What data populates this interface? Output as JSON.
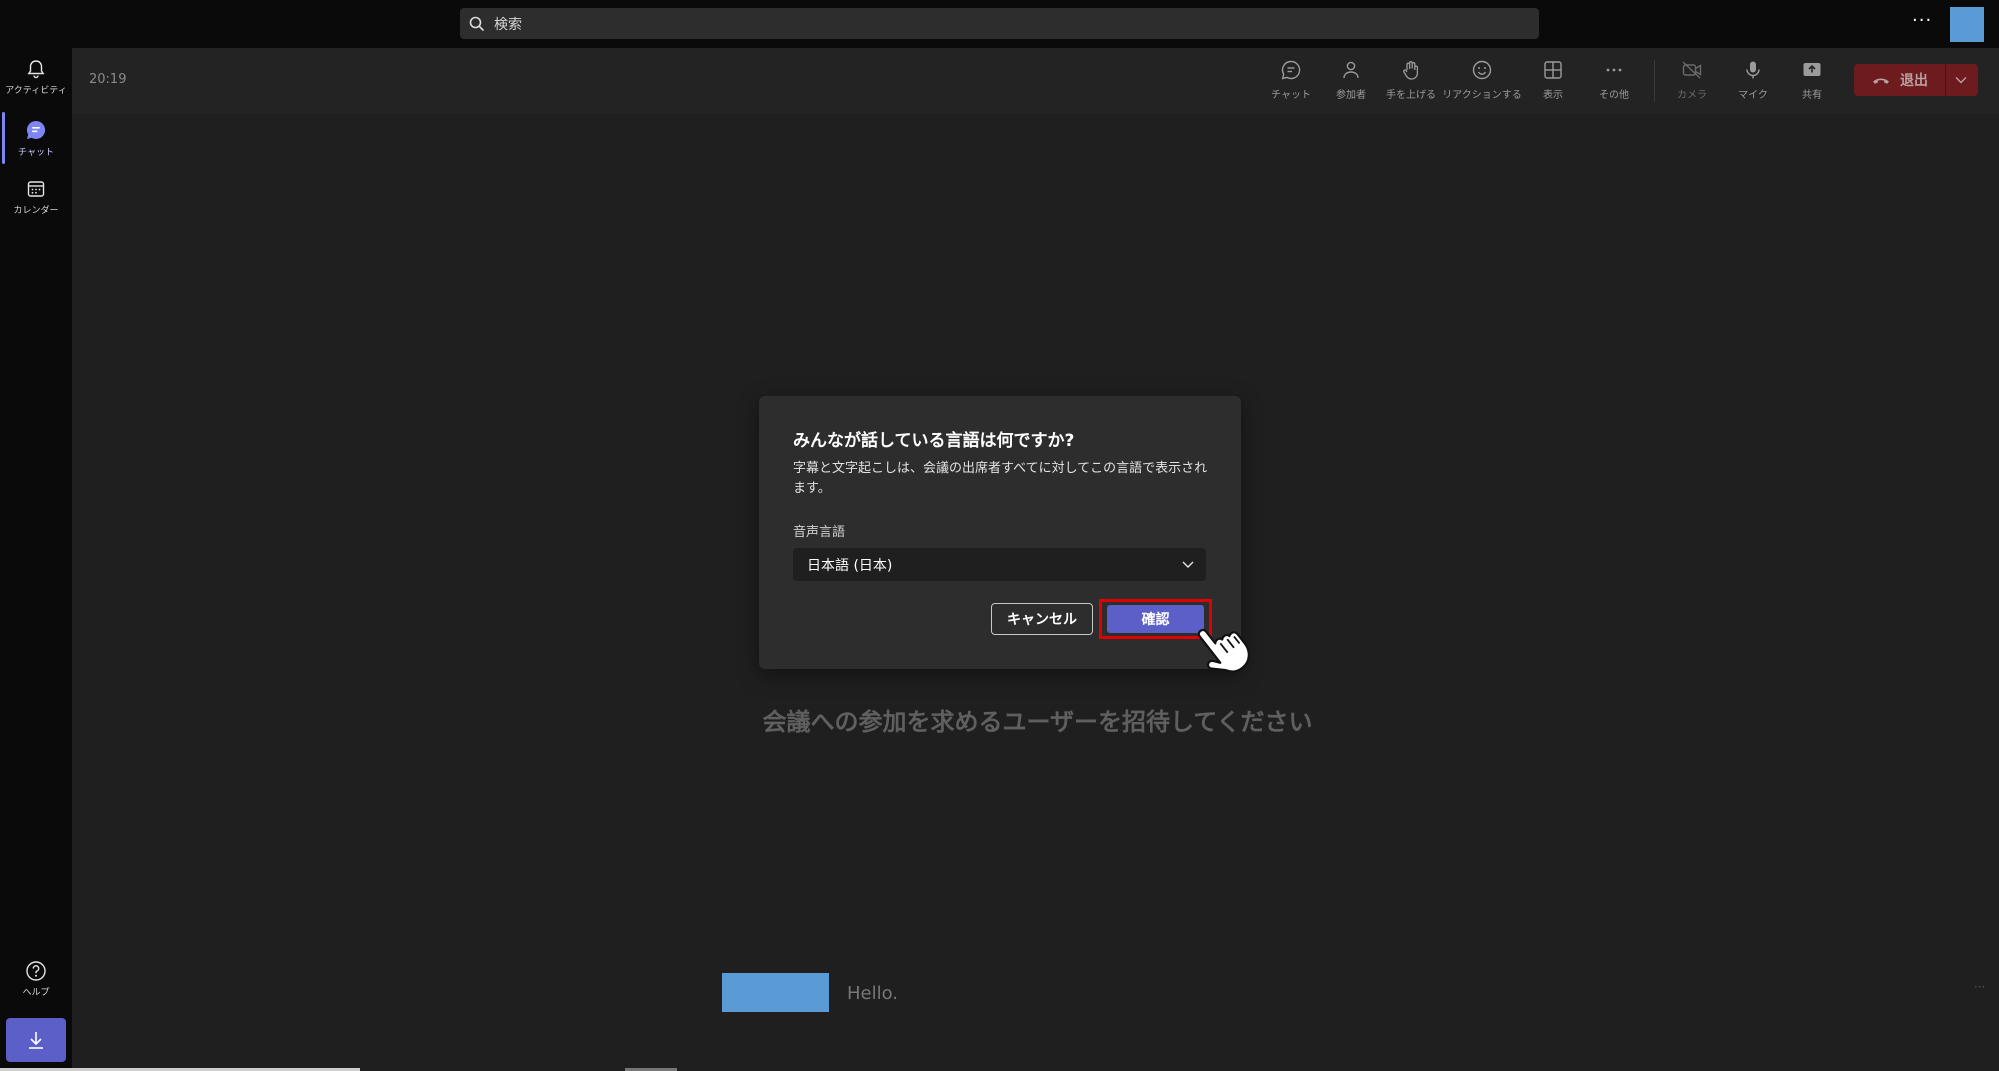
{
  "search": {
    "placeholder": "検索"
  },
  "top": {
    "more": "···"
  },
  "rail": {
    "items": [
      {
        "label": "アクティビティ",
        "icon": "bell-icon"
      },
      {
        "label": "チャット",
        "icon": "chat-icon"
      },
      {
        "label": "カレンダー",
        "icon": "calendar-icon"
      }
    ],
    "help_label": "ヘルプ"
  },
  "meeting": {
    "time": "20:19",
    "toolbar": [
      {
        "label": "チャット",
        "icon": "chat-bubble-icon"
      },
      {
        "label": "参加者",
        "icon": "people-icon"
      },
      {
        "label": "手を上げる",
        "icon": "raise-hand-icon"
      },
      {
        "label": "リアクションする",
        "icon": "smiley-icon"
      },
      {
        "label": "表示",
        "icon": "grid-icon"
      },
      {
        "label": "その他",
        "icon": "more-icon"
      },
      {
        "label": "カメラ",
        "icon": "camera-off-icon"
      },
      {
        "label": "マイク",
        "icon": "mic-icon"
      },
      {
        "label": "共有",
        "icon": "share-icon"
      }
    ],
    "more_glyph": "···",
    "leave_label": "退出"
  },
  "dialog": {
    "title": "みんなが話している言語は何ですか?",
    "description": "字幕と文字起こしは、会議の出席者すべてに対してこの言語で表示されます。",
    "language_label": "音声言語",
    "language_value": "日本語 (日本)",
    "cancel_label": "キャンセル",
    "confirm_label": "確認"
  },
  "stage": {
    "invite_text": "会議への参加を求めるユーザーを招待してください",
    "hello": "Hello.",
    "corner_dots": "···"
  },
  "colors": {
    "accent": "#5b5fc7",
    "leave": "#6e1b1f",
    "highlight": "#e00000",
    "avatar": "#5b9bd5"
  }
}
